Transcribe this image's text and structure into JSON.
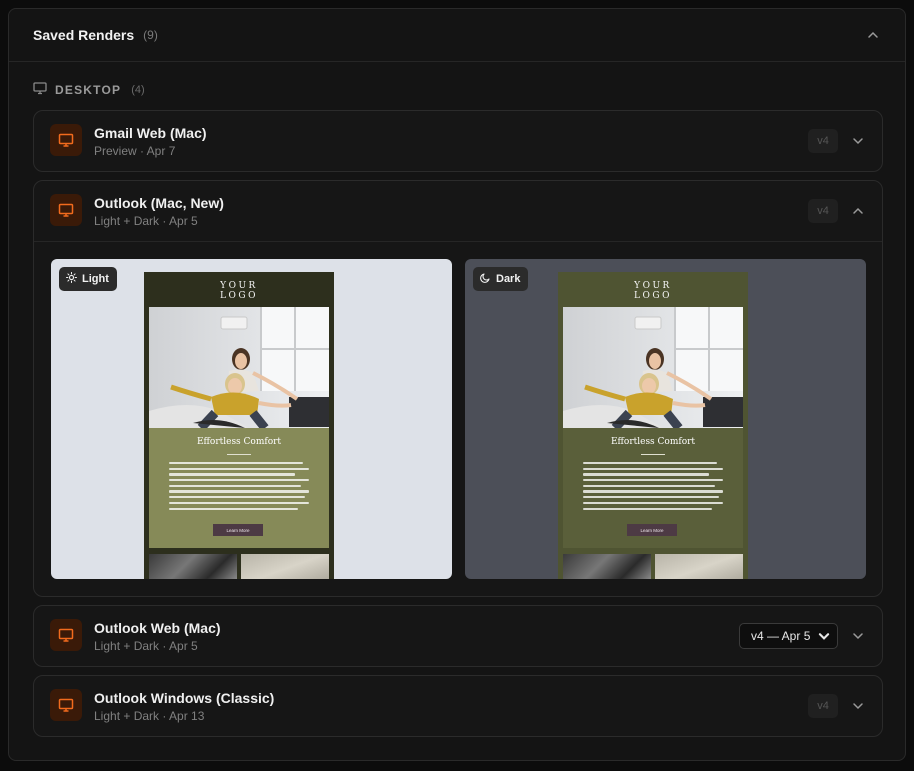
{
  "panel": {
    "title": "Saved Renders",
    "count": "(9)"
  },
  "section": {
    "label": "DESKTOP",
    "count": "(4)"
  },
  "renders": [
    {
      "name": "Gmail Web (Mac)",
      "sub": "Preview · Apr 7",
      "version": "v4",
      "expanded": false
    },
    {
      "name": "Outlook (Mac, New)",
      "sub": "Light + Dark · Apr 5",
      "version": "v4",
      "expanded": true
    },
    {
      "name": "Outlook Web (Mac)",
      "sub": "Light + Dark · Apr 5",
      "version_select": "v4 — Apr 5",
      "expanded": false
    },
    {
      "name": "Outlook Windows (Classic)",
      "sub": "Light + Dark · Apr 13",
      "version": "v4",
      "expanded": false
    }
  ],
  "previews": {
    "light_label": "Light",
    "dark_label": "Dark",
    "email": {
      "logo_line1": "YOUR",
      "logo_line2": "LOGO",
      "heading": "Effortless Comfort",
      "button": "Learn More"
    }
  },
  "colors": {
    "accent_orange": "#f26b1d",
    "icon_bg": "#3a1a08",
    "light_canvas": "#dde1e8",
    "dark_canvas": "#4c4f58"
  },
  "icons": {
    "client": "monitor-icon",
    "section": "monitor-icon",
    "light_mode": "sun-icon",
    "dark_mode": "moon-icon",
    "collapse": "chevron-up-icon",
    "expand": "chevron-down-icon"
  }
}
